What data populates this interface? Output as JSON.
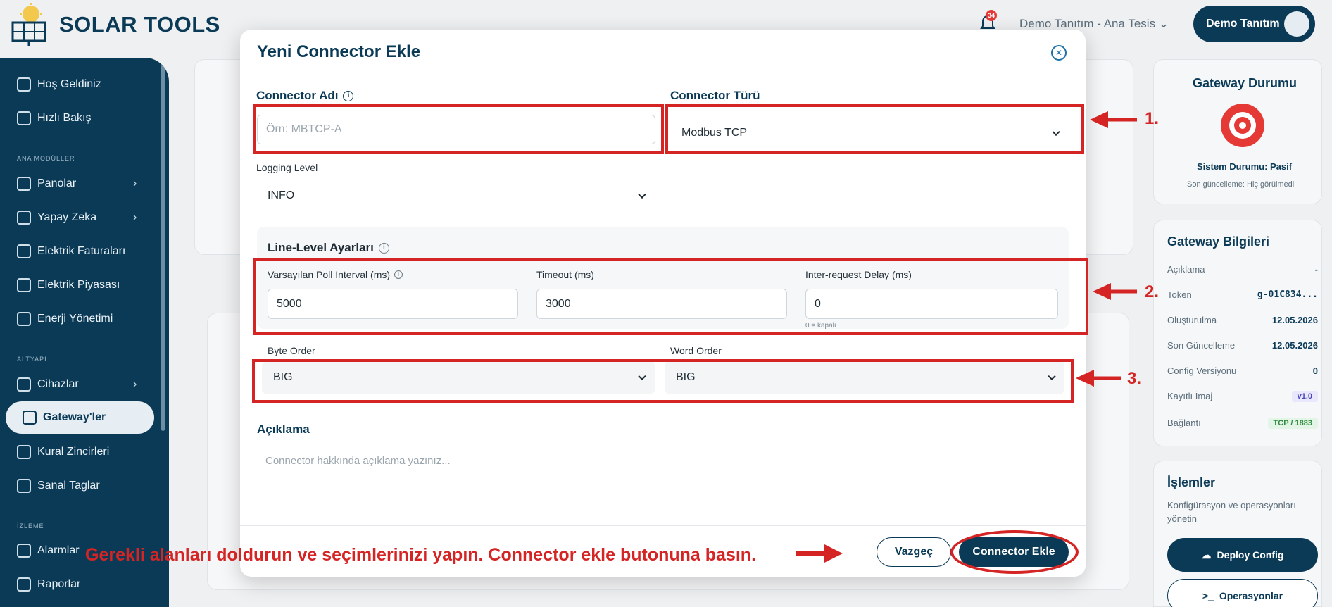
{
  "app": {
    "brand": "SOLAR TOOLS",
    "notification_count": "34",
    "tenant": "Demo Tanıtım - Ana Tesis",
    "user": "Demo Tanıtım"
  },
  "sidebar": {
    "items": [
      {
        "label": "Hoş Geldiniz"
      },
      {
        "label": "Hızlı Bakış"
      },
      {
        "label": "Panolar"
      },
      {
        "label": "Yapay Zeka"
      },
      {
        "label": "Elektrik Faturaları"
      },
      {
        "label": "Elektrik Piyasası"
      },
      {
        "label": "Enerji Yönetimi"
      },
      {
        "label": "Cihazlar"
      },
      {
        "label": "Gateway'ler"
      },
      {
        "label": "Kural Zincirleri"
      },
      {
        "label": "Sanal Taglar"
      },
      {
        "label": "Alarmlar"
      },
      {
        "label": "Raporlar"
      }
    ],
    "sections": [
      "ANA MODÜLLER",
      "ALTYAPI",
      "İZLEME"
    ]
  },
  "right_panel": {
    "status_title": "Gateway Durumu",
    "status_text": "Sistem Durumu: Pasif",
    "last_update": "Son güncelleme: Hiç görülmedi",
    "info_title": "Gateway Bilgileri",
    "rows": [
      {
        "k": "Açıklama",
        "v": "-"
      },
      {
        "k": "Token",
        "v": "g-01C834..."
      },
      {
        "k": "Oluşturulma",
        "v": "12.05.2026"
      },
      {
        "k": "Son Güncelleme",
        "v": "12.05.2026"
      },
      {
        "k": "Config Versiyonu",
        "v": "0"
      },
      {
        "k": "Kayıtlı İmaj",
        "v": "v1.0"
      },
      {
        "k": "Bağlantı",
        "v": "TCP / 1883"
      }
    ],
    "ops_title": "İşlemler",
    "ops_desc": "Konfigürasyon ve operasyonları yönetin",
    "deploy_label": "Deploy Config",
    "ops_label": "Operasyonlar"
  },
  "modal": {
    "title": "Yeni Connector Ekle",
    "connector_name_label": "Connector Adı",
    "connector_name_placeholder": "Örn: MBTCP-A",
    "connector_type_label": "Connector Türü",
    "connector_type_value": "Modbus TCP",
    "logging_label": "Logging Level",
    "logging_value": "INFO",
    "line_level_title": "Line-Level Ayarları",
    "poll_label": "Varsayılan Poll Interval (ms)",
    "poll_value": "5000",
    "timeout_label": "Timeout (ms)",
    "timeout_value": "3000",
    "delay_label": "Inter-request Delay (ms)",
    "delay_value": "0",
    "delay_hint": "0 = kapalı",
    "byte_order_label": "Byte Order",
    "byte_order_value": "BIG",
    "word_order_label": "Word Order",
    "word_order_value": "BIG",
    "description_label": "Açıklama",
    "description_placeholder": "Connector hakkında açıklama yazınız...",
    "cancel_label": "Vazgeç",
    "submit_label": "Connector Ekle"
  },
  "annotations": {
    "step1": "1.",
    "step2": "2.",
    "step3": "3.",
    "caption": "Gerekli alanları doldurun ve seçimlerinizi yapın. Connector ekle butonuna basın.",
    "color": "#d42424"
  },
  "colors": {
    "brand_navy": "#0b3a57",
    "status_red": "#e53935"
  }
}
